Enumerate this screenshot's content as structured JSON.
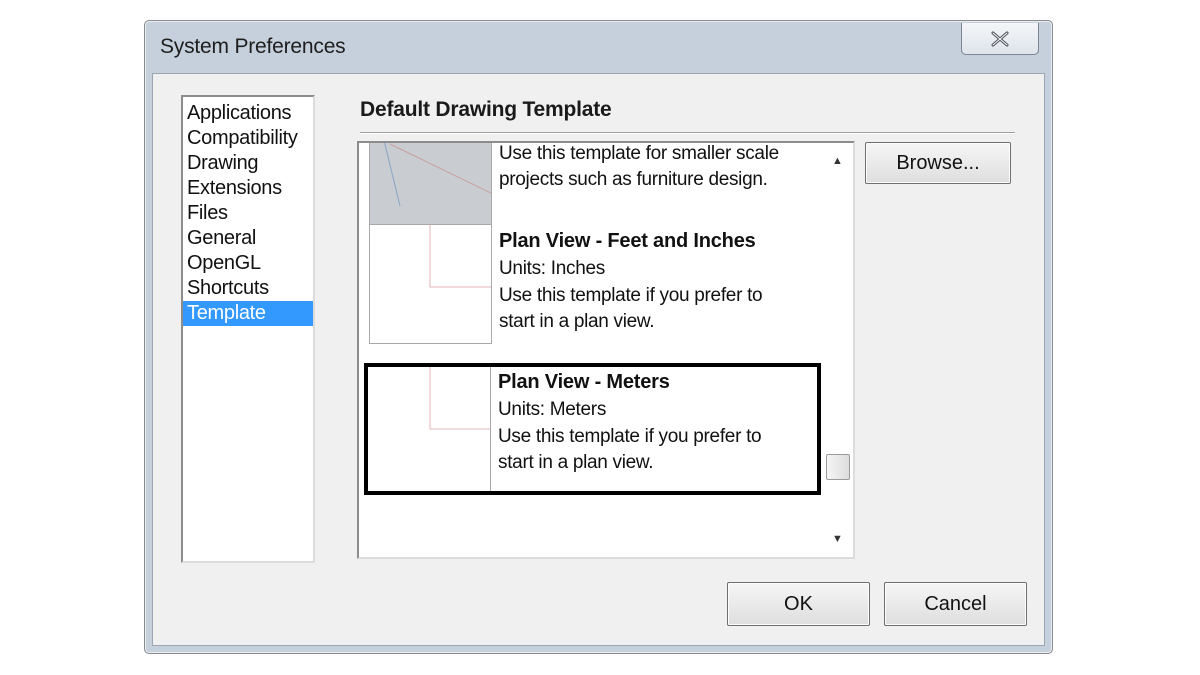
{
  "window": {
    "title": "System Preferences"
  },
  "sidebar": {
    "items": [
      {
        "label": "Applications",
        "selected": false
      },
      {
        "label": "Compatibility",
        "selected": false
      },
      {
        "label": "Drawing",
        "selected": false
      },
      {
        "label": "Extensions",
        "selected": false
      },
      {
        "label": "Files",
        "selected": false
      },
      {
        "label": "General",
        "selected": false
      },
      {
        "label": "OpenGL",
        "selected": false
      },
      {
        "label": "Shortcuts",
        "selected": false
      },
      {
        "label": "Template",
        "selected": true
      }
    ]
  },
  "main": {
    "section_title": "Default Drawing Template",
    "templates": [
      {
        "name": "",
        "units": "",
        "description_1": "Use this template for smaller scale",
        "description_2": "projects such as furniture design."
      },
      {
        "name": "Plan View - Feet and Inches",
        "units": "Units: Inches",
        "description_1": "Use this template if you prefer to",
        "description_2": "start in a plan view."
      },
      {
        "name": "Plan View - Meters",
        "units": "Units: Meters",
        "description_1": "Use this template if you prefer to",
        "description_2": "start in a plan view.",
        "selected": true
      }
    ],
    "browse_label": "Browse..."
  },
  "footer": {
    "ok_label": "OK",
    "cancel_label": "Cancel"
  },
  "colors": {
    "selection": "#3399ff",
    "window_frame": "#c6d0dc",
    "client_bg": "#f0f0f0"
  }
}
